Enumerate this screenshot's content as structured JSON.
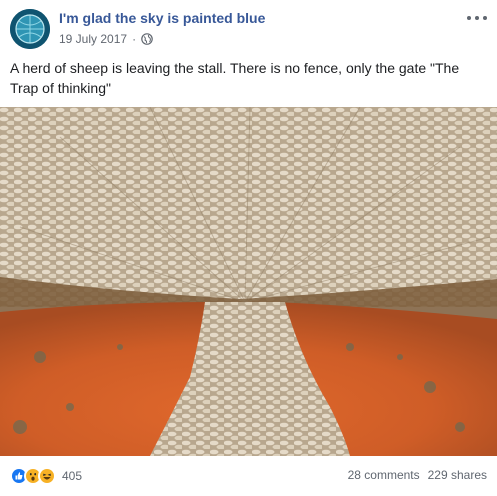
{
  "post": {
    "page_name": "I'm glad the sky is painted blue",
    "date": "19 July 2017",
    "separator": "·",
    "privacy_icon": "globe-icon",
    "menu_icon": "more-dots-icon",
    "caption": "A herd of sheep is leaving the stall. There is no fence, only the gate \"The Trap of thinking\"",
    "image_alt": "aerial photo of sheep"
  },
  "footer": {
    "reaction_icons": [
      "like-icon",
      "wow-icon",
      "haha-icon"
    ],
    "reaction_count": "405",
    "comments": "28 comments",
    "shares": "229 shares"
  },
  "colors": {
    "link": "#385898",
    "secondary_text": "#616770",
    "like_blue": "#1877f2",
    "emoji_yellow": "#f7b125",
    "soil_orange": "#d8642c"
  }
}
